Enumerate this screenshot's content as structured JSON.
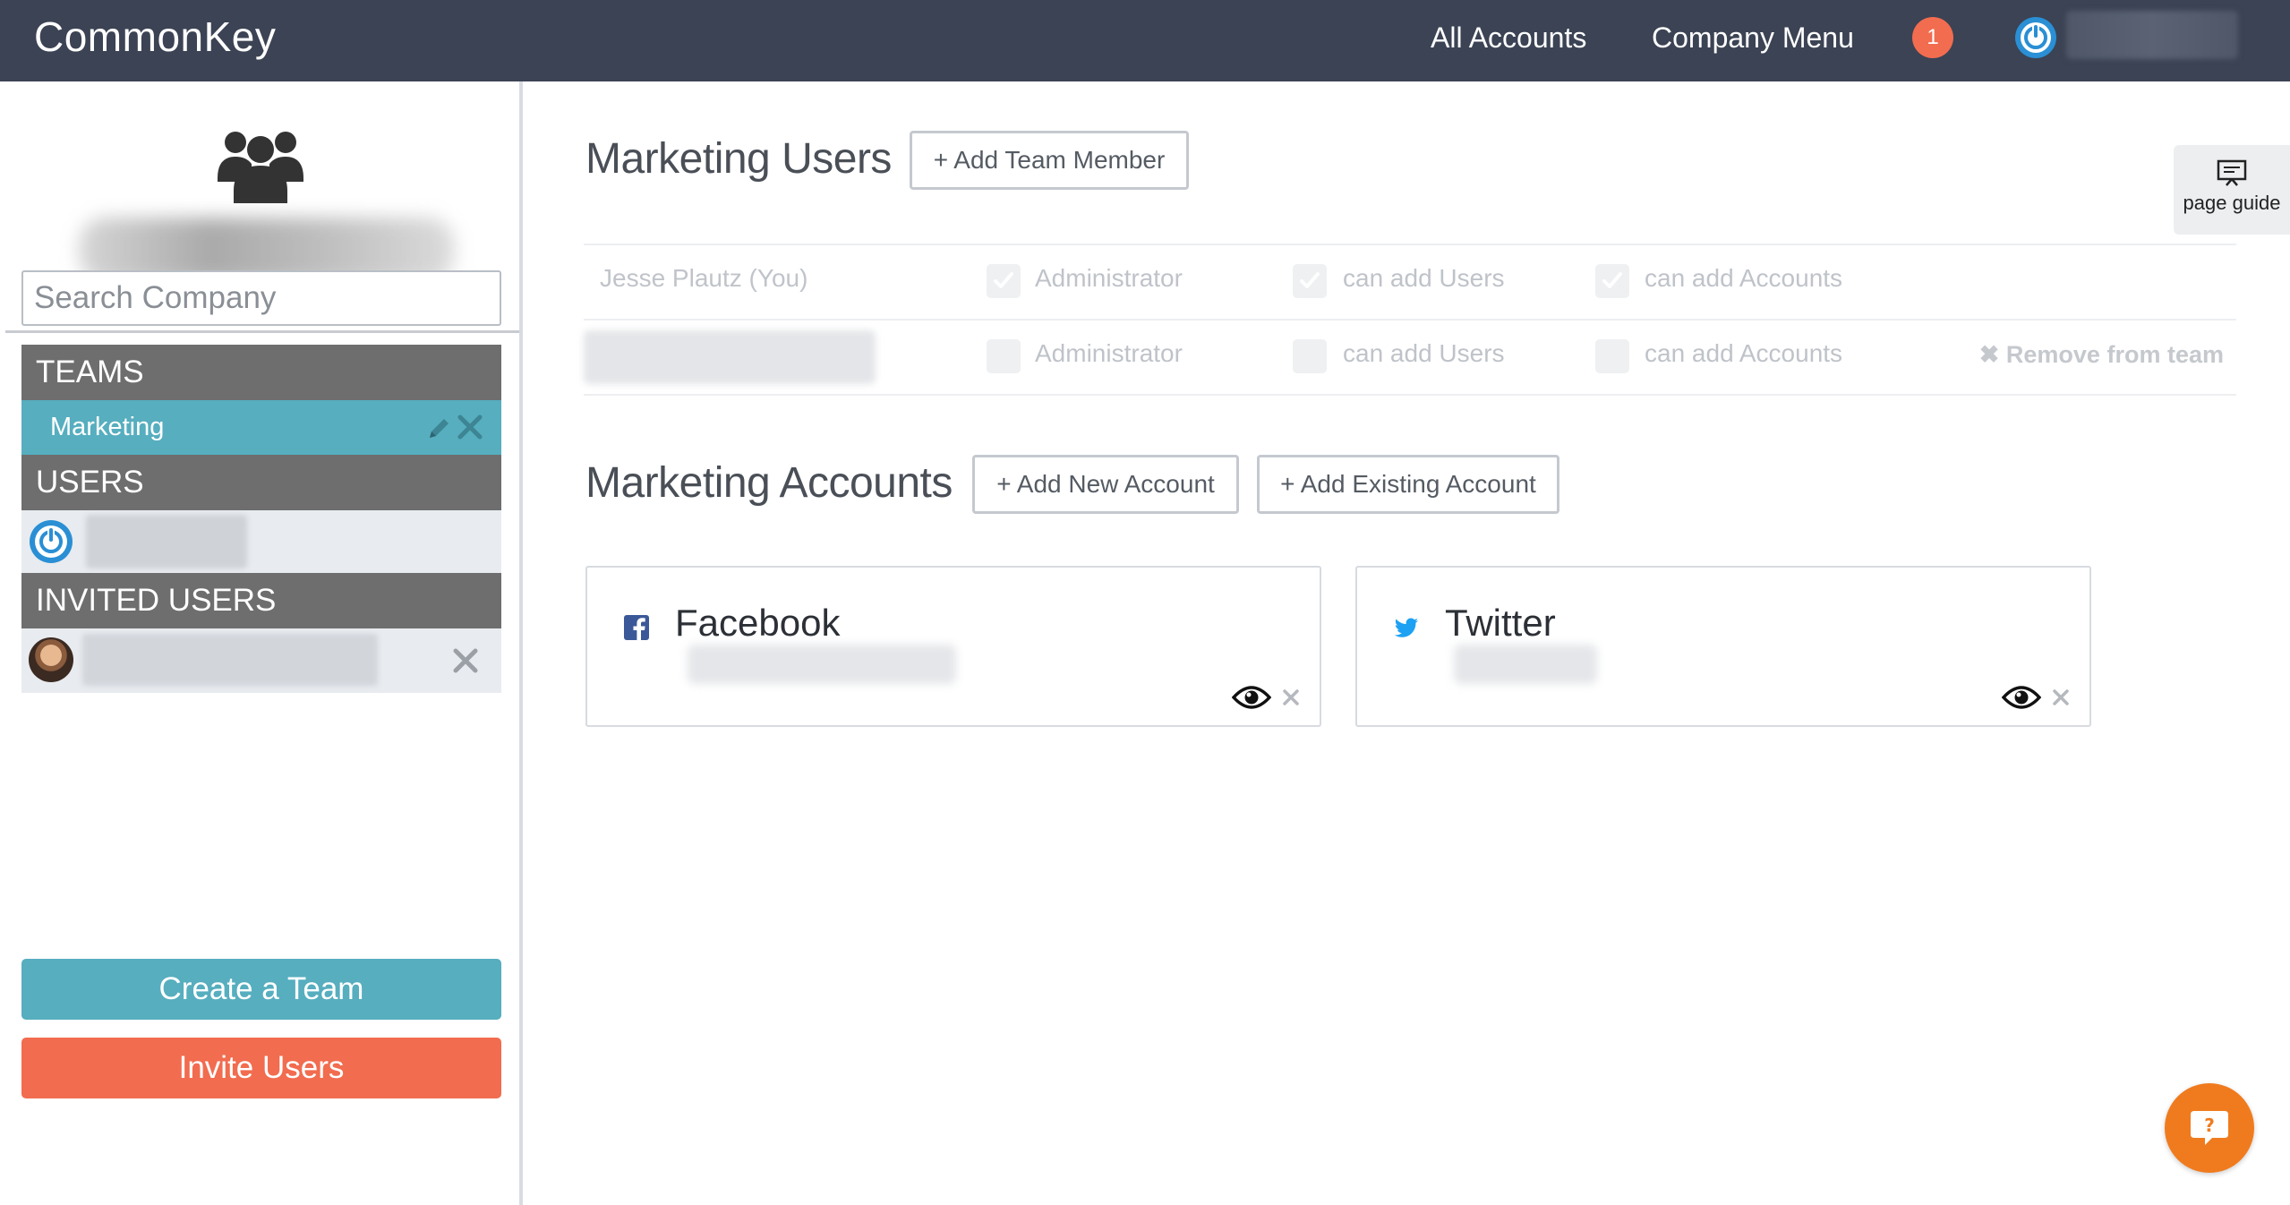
{
  "app": {
    "brand": "CommonKey"
  },
  "topnav": {
    "all_accounts": "All Accounts",
    "company_menu": "Company Menu",
    "notification_count": "1"
  },
  "sidebar": {
    "search_placeholder": "Search Company",
    "teams_heading": "TEAMS",
    "teams": [
      {
        "name": "Marketing"
      }
    ],
    "users_heading": "USERS",
    "invited_heading": "INVITED USERS",
    "create_team": "Create a Team",
    "invite_users": "Invite Users"
  },
  "main": {
    "users_title": "Marketing Users",
    "add_team_member": "+ Add Team Member",
    "page_guide": "page guide",
    "members": [
      {
        "name": "Jesse Plautz (You)",
        "administrator": true,
        "can_add_users": true,
        "can_add_accounts": true
      },
      {
        "name": "",
        "administrator": false,
        "can_add_users": false,
        "can_add_accounts": false,
        "remove_label": "Remove from team"
      }
    ],
    "perm_labels": {
      "administrator": "Administrator",
      "can_add_users": "can add Users",
      "can_add_accounts": "can add Accounts"
    },
    "accounts_title": "Marketing Accounts",
    "add_new_account": "+ Add New Account",
    "add_existing_account": "+ Add Existing Account",
    "accounts": [
      {
        "name": "Facebook",
        "icon": "facebook-icon"
      },
      {
        "name": "Twitter",
        "icon": "twitter-icon"
      }
    ]
  },
  "colors": {
    "topbar": "#3b4354",
    "teal": "#56aebf",
    "coral": "#f26c4f",
    "section_head": "#6e6e6e",
    "help_orange": "#f07b1e",
    "facebook": "#3b5998",
    "twitter": "#1da1f2"
  }
}
